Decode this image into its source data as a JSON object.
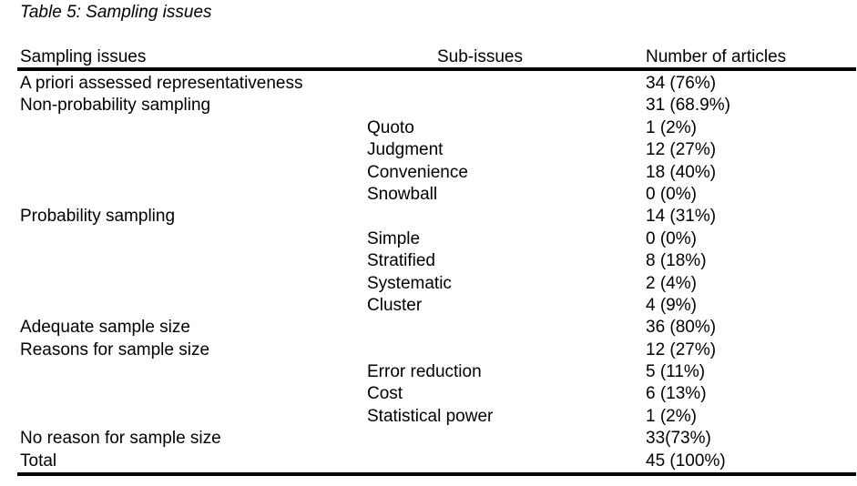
{
  "caption": "Table 5: Sampling issues",
  "headers": {
    "issue": "Sampling issues",
    "sub": "Sub-issues",
    "count": "Number of articles"
  },
  "rows": [
    {
      "issue": "A priori assessed representativeness",
      "sub": "",
      "count": "34 (76%)"
    },
    {
      "issue": "Non-probability sampling",
      "sub": "",
      "count": "31 (68.9%)"
    },
    {
      "issue": "",
      "sub": "Quoto",
      "count": "1 (2%)"
    },
    {
      "issue": "",
      "sub": "Judgment",
      "count": "12 (27%)"
    },
    {
      "issue": "",
      "sub": "Convenience",
      "count": "18 (40%)"
    },
    {
      "issue": "",
      "sub": "Snowball",
      "count": "0 (0%)"
    },
    {
      "issue": "Probability sampling",
      "sub": "",
      "count": "14 (31%)"
    },
    {
      "issue": "",
      "sub": "Simple",
      "count": "0 (0%)"
    },
    {
      "issue": "",
      "sub": "Stratified",
      "count": "8 (18%)"
    },
    {
      "issue": "",
      "sub": "Systematic",
      "count": "2 (4%)"
    },
    {
      "issue": "",
      "sub": "Cluster",
      "count": "4 (9%)"
    },
    {
      "issue": "Adequate sample size",
      "sub": "",
      "count": "36 (80%)"
    },
    {
      "issue": "Reasons for sample size",
      "sub": "",
      "count": "12 (27%)"
    },
    {
      "issue": "",
      "sub": "Error reduction",
      "count": "5 (11%)"
    },
    {
      "issue": "",
      "sub": "Cost",
      "count": "6 (13%)"
    },
    {
      "issue": "",
      "sub": "Statistical power",
      "count": "1 (2%)"
    },
    {
      "issue": "No reason for sample size",
      "sub": "",
      "count": "33(73%)"
    },
    {
      "issue": "Total",
      "sub": "",
      "count": "45 (100%)"
    }
  ]
}
